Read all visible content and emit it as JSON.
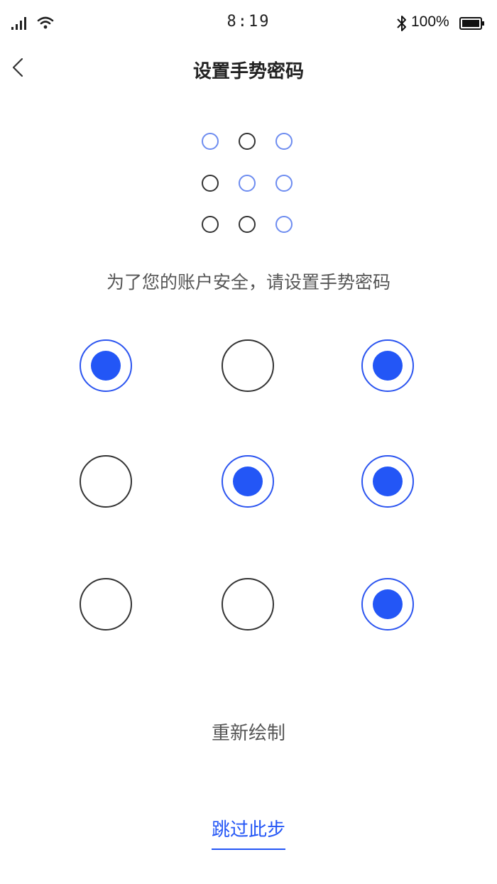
{
  "status_bar": {
    "time": "8:19",
    "battery": "100%",
    "icons": [
      "signal-icon",
      "wifi-icon",
      "bluetooth-icon",
      "battery-icon"
    ]
  },
  "nav": {
    "title": "设置手势密码",
    "back_icon": "chevron-left-icon"
  },
  "preview": {
    "selected": [
      true,
      false,
      true,
      false,
      true,
      true,
      false,
      false,
      true
    ]
  },
  "instruction": "为了您的账户安全，请设置手势密码",
  "pattern": {
    "selected": [
      true,
      false,
      true,
      false,
      true,
      true,
      false,
      false,
      true
    ]
  },
  "actions": {
    "redraw": "重新绘制",
    "skip": "跳过此步"
  },
  "colors": {
    "accent": "#2356f6",
    "preview_active": "#6d8cf0",
    "inactive_border": "#333333"
  }
}
